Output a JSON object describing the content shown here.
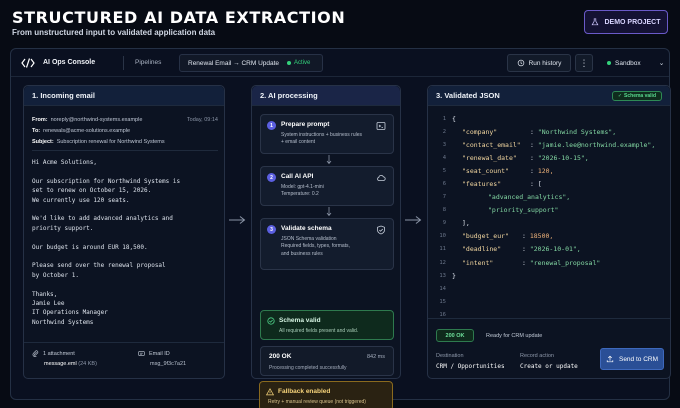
{
  "hero": {
    "title": "STRUCTURED AI DATA EXTRACTION",
    "subtitle": "From unstructured input to validated application data",
    "demo_label": "DEMO PROJECT"
  },
  "topbar": {
    "app_title": "AI Ops Console",
    "pipelines_label": "Pipelines",
    "pipeline_name": "Renewal Email → CRM Update",
    "pipeline_status": "Active",
    "run_history_label": "Run history",
    "more_label": "⋮",
    "environment": "Sandbox",
    "environment_chevron": "⌄"
  },
  "email_panel": {
    "title": "1. Incoming email",
    "from_label": "From:",
    "from_value": "noreply@northwind-systems.example",
    "date": "Today, 09:14",
    "to_label": "To:",
    "to_value": "renewals@acme-solutions.example",
    "subject_label": "Subject:",
    "subject_value": "Subscription renewal for Northwind Systems",
    "body": [
      "Hi Acme Solutions,",
      "Our subscription for Northwind Systems is\nset to renew on October 15, 2026.\nWe currently use 120 seats.",
      "We'd like to add advanced analytics and\npriority support.",
      "Our budget is around EUR 18,500.",
      "Please send over the renewal proposal\nby October 1.",
      "Thanks,\nJamie Lee\nIT Operations Manager\nNorthwind Systems"
    ],
    "attachment_count": "1 attachment",
    "attachment_file": "message.eml",
    "attachment_size": "(24 KB)",
    "email_id_label": "Email ID",
    "email_id_value": "msg_9f3c7a21"
  },
  "processing_panel": {
    "title": "2. AI processing",
    "steps": [
      {
        "num": "1",
        "title": "Prepare prompt",
        "desc": "System instructions + business rules\n+ email content"
      },
      {
        "num": "2",
        "title": "Call AI API",
        "desc": "Model: gpt-4.1-mini\nTemperature: 0.2"
      },
      {
        "num": "3",
        "title": "Validate schema",
        "desc": "JSON Schema validation\nRequired fields, types, formats,\nand business rules"
      }
    ],
    "schema_valid_title": "Schema valid",
    "schema_valid_desc": "All required fields present and valid.",
    "ok_title": "200 OK",
    "ok_ms": "842 ms",
    "ok_desc": "Processing completed successfully",
    "fallback_title": "Fallback enabled",
    "fallback_desc": "Retry + manual review queue (not triggered)"
  },
  "json_panel": {
    "title": "3. Validated JSON",
    "badge": "Schema valid",
    "lines": [
      {
        "n": "1"
      },
      {
        "n": "2"
      },
      {
        "n": "3"
      },
      {
        "n": "4"
      },
      {
        "n": "5"
      },
      {
        "n": "6"
      },
      {
        "n": "7"
      },
      {
        "n": "8"
      },
      {
        "n": "9"
      },
      {
        "n": "10"
      },
      {
        "n": "11"
      },
      {
        "n": "12"
      },
      {
        "n": "13"
      },
      {
        "n": "14"
      },
      {
        "n": "15"
      },
      {
        "n": "16"
      }
    ],
    "code": {
      "open": "{",
      "company_key": "\"company\"",
      "company_val": "\"Northwind Systems\",",
      "contact_key": "\"contact_email\"",
      "contact_val": "\"jamie.lee@northwind.example\",",
      "renewal_key": "\"renewal_date\"",
      "renewal_val": "\"2026-10-15\",",
      "seat_key": "\"seat_count\"",
      "seat_val": "120,",
      "features_key": "\"features\"",
      "features_open": "[",
      "feature_1": "\"advanced_analytics\",",
      "feature_2": "\"priority_support\"",
      "features_close": "],",
      "budget_key": "\"budget_eur\"",
      "budget_val": "18500,",
      "deadline_key": "\"deadline\"",
      "deadline_val": "\"2026-10-01\",",
      "intent_key": "\"intent\"",
      "intent_val": "\"renewal_proposal\"",
      "close": "}",
      "colon": ":"
    },
    "ok_chip": "200 OK",
    "ready_text": "Ready for CRM update",
    "destination_label": "Destination",
    "destination_value": "CRM / Opportunities",
    "record_action_label": "Record action",
    "record_action_value": "Create or update",
    "send_label": "Send to CRM"
  },
  "colors": {
    "accent": "#5b5fe0",
    "success": "#34d27b",
    "warning": "#f6d37a",
    "primary_button": "#2a4f96"
  }
}
